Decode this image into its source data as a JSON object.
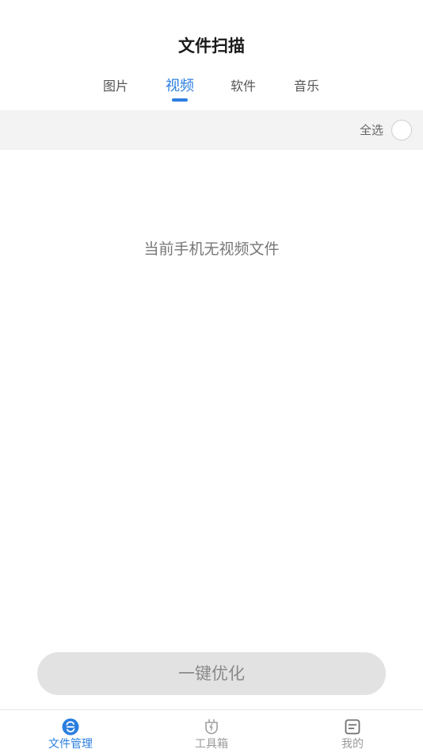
{
  "header": {
    "title": "文件扫描"
  },
  "tabs": [
    {
      "label": "图片"
    },
    {
      "label": "视频"
    },
    {
      "label": "软件"
    },
    {
      "label": "音乐"
    }
  ],
  "active_tab": "视频",
  "select_bar": {
    "select_all_label": "全选",
    "checked": false
  },
  "empty_state": {
    "message": "当前手机无视频文件"
  },
  "optimize_button": {
    "label": "一键优化"
  },
  "bottom_nav": {
    "items": [
      {
        "label": "文件管理",
        "icon": "file-manager-icon",
        "active": true
      },
      {
        "label": "工具箱",
        "icon": "toolbox-plug-icon",
        "active": false
      },
      {
        "label": "我的",
        "icon": "profile-note-icon",
        "active": false
      }
    ]
  },
  "colors": {
    "accent": "#2b7fe0",
    "inactive": "#9a9a9a",
    "select_bar_bg": "#f3f3f3",
    "button_bg": "#e2e2e2"
  }
}
